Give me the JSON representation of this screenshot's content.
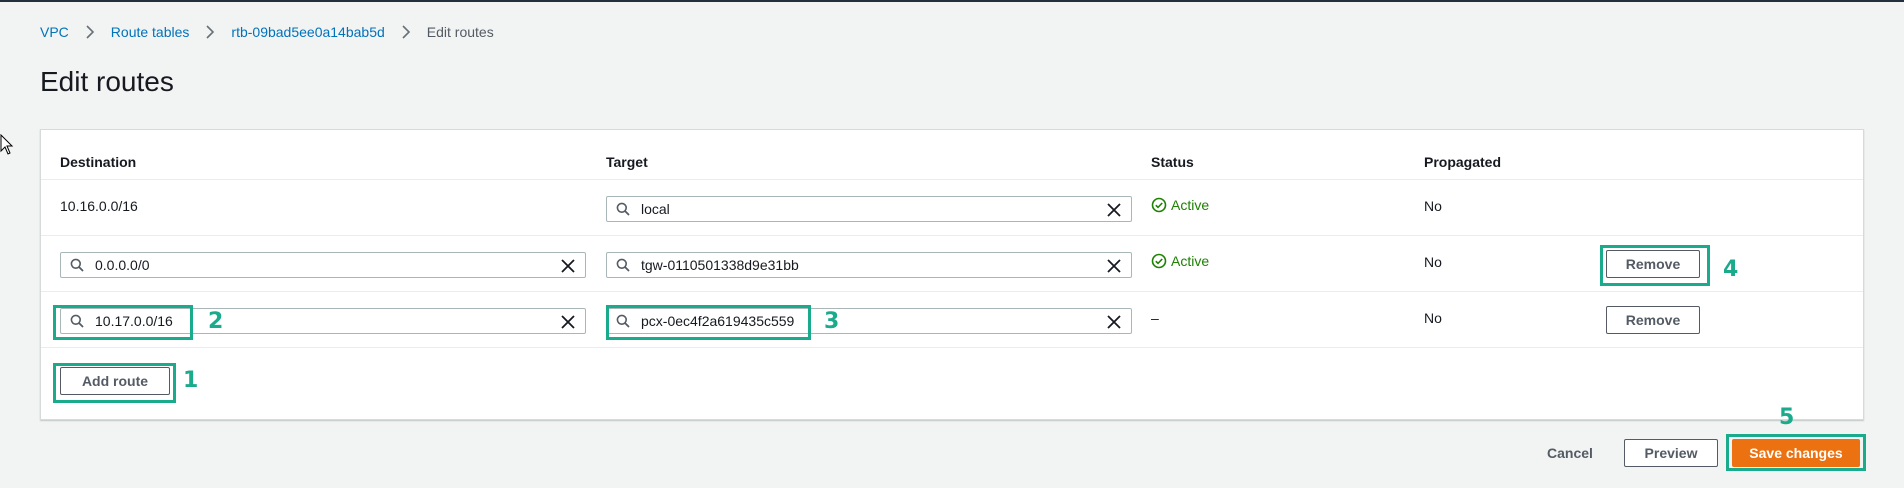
{
  "breadcrumb": {
    "items": [
      {
        "label": "VPC"
      },
      {
        "label": "Route tables"
      },
      {
        "label": "rtb-09bad5ee0a14bab5d"
      }
    ],
    "current": "Edit routes"
  },
  "page": {
    "title": "Edit routes"
  },
  "table": {
    "columns": [
      "Destination",
      "Target",
      "Status",
      "Propagated"
    ],
    "rows": [
      {
        "destination": "10.16.0.0/16",
        "target": "local",
        "status": "Active",
        "propagated": "No"
      },
      {
        "destination": "0.0.0.0/0",
        "target": "tgw-0110501338d9e31bb",
        "status": "Active",
        "propagated": "No",
        "remove_label": "Remove"
      },
      {
        "destination": "10.17.0.0/16",
        "target": "pcx-0ec4f2a619435c559",
        "status": "–",
        "propagated": "No",
        "remove_label": "Remove"
      }
    ],
    "add_route_label": "Add route"
  },
  "footer": {
    "cancel_label": "Cancel",
    "preview_label": "Preview",
    "save_label": "Save changes"
  },
  "annotations": [
    "1",
    "2",
    "3",
    "4",
    "5"
  ],
  "colors": {
    "link": "#0073bb",
    "status_active": "#1d8102",
    "primary_button": "#ec7211",
    "annotation": "#1aaa8c"
  }
}
